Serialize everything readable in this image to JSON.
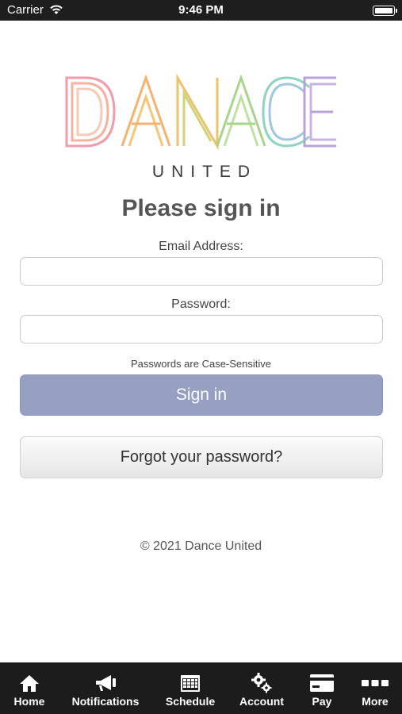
{
  "status_bar": {
    "carrier": "Carrier",
    "time": "9:46 PM"
  },
  "logo": {
    "wordmark": "DANCE",
    "subtitle": "UNITED"
  },
  "form": {
    "title": "Please sign in",
    "email_label": "Email Address:",
    "email_value": "",
    "password_label": "Password:",
    "password_value": "",
    "hint": "Passwords are Case-Sensitive",
    "signin_label": "Sign in",
    "forgot_label": "Forgot your password?"
  },
  "footer": {
    "copyright": "© 2021 Dance United"
  },
  "tabs": [
    {
      "label": "Home",
      "icon": "home-icon"
    },
    {
      "label": "Notifications",
      "icon": "megaphone-icon"
    },
    {
      "label": "Schedule",
      "icon": "calendar-icon"
    },
    {
      "label": "Account",
      "icon": "gears-icon"
    },
    {
      "label": "Pay",
      "icon": "credit-card-icon"
    },
    {
      "label": "More",
      "icon": "more-dots-icon"
    }
  ],
  "colors": {
    "signin_button": "#95a0c2",
    "tab_bar": "#1c1c1c",
    "logo_d": "#f29bab",
    "logo_a": "#f6c27a",
    "logo_n": "#e8c170",
    "logo_c": "#8fd3c1",
    "logo_e": "#b8a3d8"
  }
}
